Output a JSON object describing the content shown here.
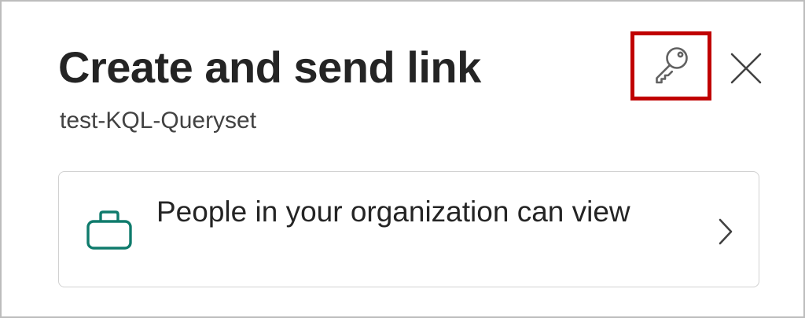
{
  "dialog": {
    "title": "Create and send link",
    "subtitle": "test-KQL-Queryset"
  },
  "header_buttons": {
    "permissions_icon": "key-icon",
    "close_icon": "close-icon"
  },
  "link_setting": {
    "icon": "briefcase-icon",
    "label": "People in your organization can view",
    "chevron_icon": "chevron-right-icon"
  },
  "colors": {
    "highlight_box": "#c00000",
    "briefcase_icon": "#0f7b6c",
    "title_text": "#242424"
  }
}
